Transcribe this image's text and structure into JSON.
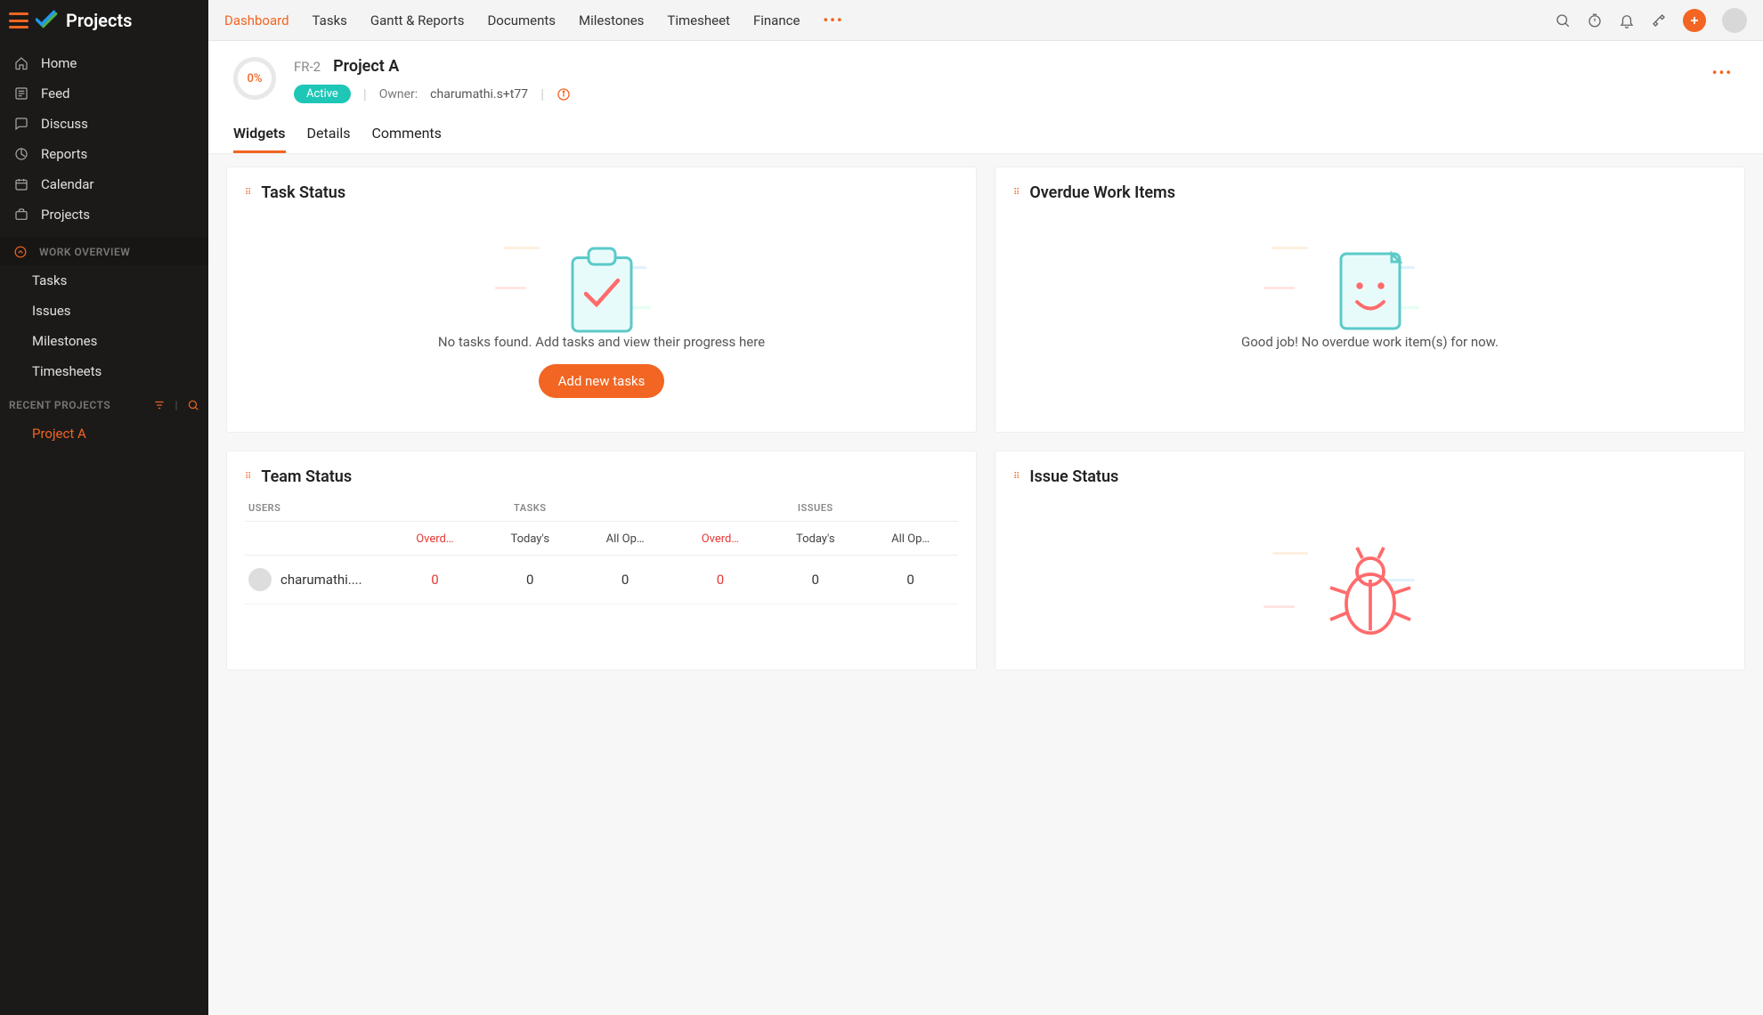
{
  "app": {
    "name": "Projects"
  },
  "sidebar": {
    "items": [
      {
        "label": "Home"
      },
      {
        "label": "Feed"
      },
      {
        "label": "Discuss"
      },
      {
        "label": "Reports"
      },
      {
        "label": "Calendar"
      },
      {
        "label": "Projects"
      }
    ],
    "work_overview_label": "WORK OVERVIEW",
    "work_items": [
      {
        "label": "Tasks"
      },
      {
        "label": "Issues"
      },
      {
        "label": "Milestones"
      },
      {
        "label": "Timesheets"
      }
    ],
    "recent_label": "RECENT PROJECTS",
    "recent_items": [
      {
        "label": "Project A"
      }
    ]
  },
  "topnav": {
    "tabs": [
      {
        "label": "Dashboard",
        "active": true
      },
      {
        "label": "Tasks"
      },
      {
        "label": "Gantt & Reports"
      },
      {
        "label": "Documents"
      },
      {
        "label": "Milestones"
      },
      {
        "label": "Timesheet"
      },
      {
        "label": "Finance"
      }
    ]
  },
  "project": {
    "progress": "0%",
    "code": "FR-2",
    "name": "Project A",
    "status": "Active",
    "owner_label": "Owner:",
    "owner": "charumathi.s+t77"
  },
  "subtabs": [
    {
      "label": "Widgets",
      "active": true
    },
    {
      "label": "Details"
    },
    {
      "label": "Comments"
    }
  ],
  "widgets": {
    "task_status": {
      "title": "Task Status",
      "empty_text": "No tasks found. Add tasks and view their progress here",
      "add_button": "Add new tasks"
    },
    "overdue": {
      "title": "Overdue Work Items",
      "empty_text": "Good job! No overdue work item(s) for now."
    },
    "team_status": {
      "title": "Team Status",
      "columns": {
        "users": "USERS",
        "tasks": "TASKS",
        "issues": "ISSUES"
      },
      "subcolumns": {
        "overdue": "Overd…",
        "today": "Today's",
        "allopen": "All Op…"
      },
      "rows": [
        {
          "user": "charumathi....",
          "t_over": "0",
          "t_today": "0",
          "t_open": "0",
          "i_over": "0",
          "i_today": "0",
          "i_open": "0"
        }
      ]
    },
    "issue_status": {
      "title": "Issue Status"
    }
  }
}
